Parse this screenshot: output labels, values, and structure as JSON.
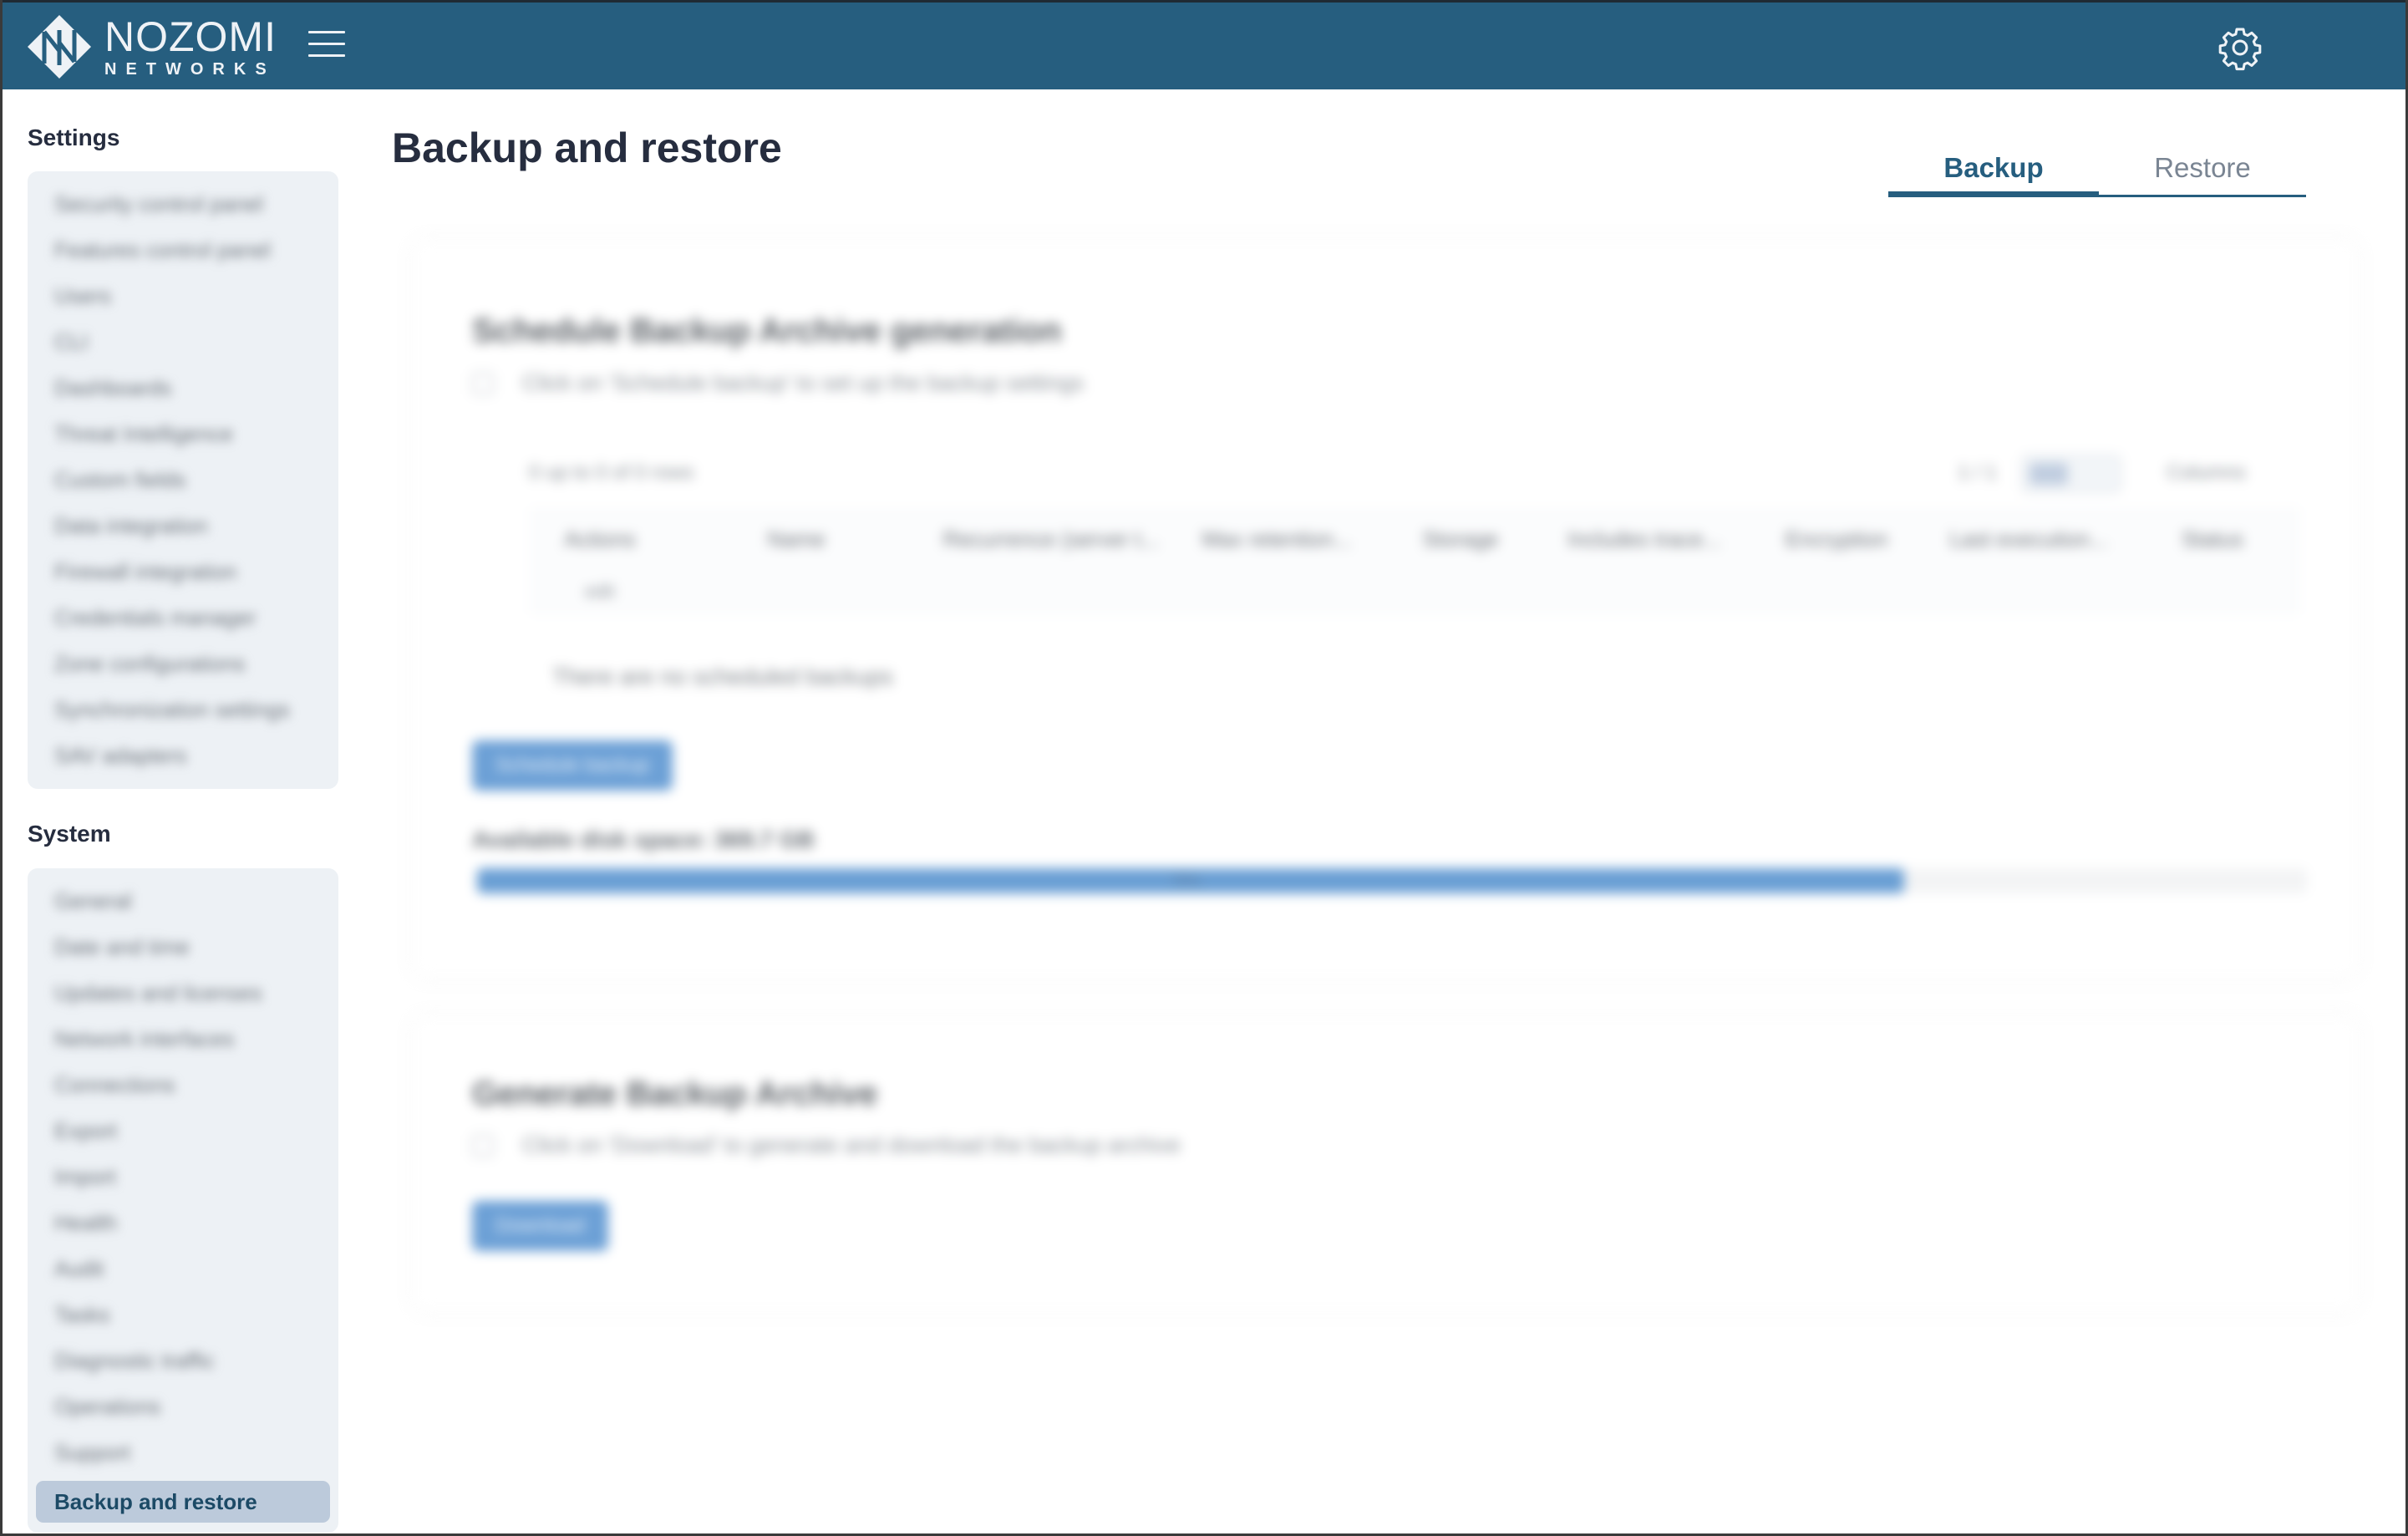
{
  "app": {
    "brand_name": "NOZOMI",
    "brand_sub": "NETWORKS",
    "colors": {
      "topbar": "#265e7f",
      "accent": "#265e7f",
      "primary_button": "#6ca0d6",
      "sidebar_bg": "#edf1f5",
      "sidebar_active_bg": "#bccadb"
    },
    "icons": {
      "logo": "nozomi-diamond-logo-icon",
      "menu": "hamburger-menu-icon",
      "settings": "gear-icon"
    }
  },
  "sidebar": {
    "settings_heading": "Settings",
    "settings_items": [
      {
        "label": "Security control panel"
      },
      {
        "label": "Features control panel"
      },
      {
        "label": "Users"
      },
      {
        "label": "CLI"
      },
      {
        "label": "Dashboards"
      },
      {
        "label": "Threat Intelligence"
      },
      {
        "label": "Custom fields"
      },
      {
        "label": "Data integration"
      },
      {
        "label": "Firewall integration"
      },
      {
        "label": "Credentials manager"
      },
      {
        "label": "Zone configurations"
      },
      {
        "label": "Synchronization settings"
      },
      {
        "label": "SAV adapters"
      }
    ],
    "system_heading": "System",
    "system_items": [
      {
        "label": "General"
      },
      {
        "label": "Date and time"
      },
      {
        "label": "Updates and licenses"
      },
      {
        "label": "Network interfaces"
      },
      {
        "label": "Connections"
      },
      {
        "label": "Export"
      },
      {
        "label": "Import"
      },
      {
        "label": "Health"
      },
      {
        "label": "Audit"
      },
      {
        "label": "Tasks"
      },
      {
        "label": "Diagnostic traffic"
      },
      {
        "label": "Operations"
      },
      {
        "label": "Support"
      }
    ],
    "active_item": "Backup and restore"
  },
  "main": {
    "page_title": "Backup and restore",
    "tabs": [
      {
        "label": "Backup",
        "active": true
      },
      {
        "label": "Restore",
        "active": false
      }
    ],
    "schedule_card": {
      "title": "Schedule Backup Archive generation",
      "hint": "Click on 'Schedule backup' to set up the backup settings",
      "table_count": "0 up to 0 of 0 rows",
      "page_label": "1 / 1",
      "columns_label": "Columns",
      "columns": [
        "Actions",
        "Name",
        "Recurrence (server t...",
        "Max retention...",
        "Storage",
        "Includes trace...",
        "Encryption",
        "Last execution...",
        "Status"
      ],
      "row_actions": "edit",
      "empty_text": "There are no scheduled backups",
      "button_label": "Schedule backup",
      "disk_label": "Available disk space: 369.7 GB",
      "disk_used_percent": 78,
      "disk_fill_label": "78%"
    },
    "generate_card": {
      "title": "Generate Backup Archive",
      "hint": "Click on 'Download' to generate and download the backup archive",
      "button_label": "Download"
    }
  }
}
